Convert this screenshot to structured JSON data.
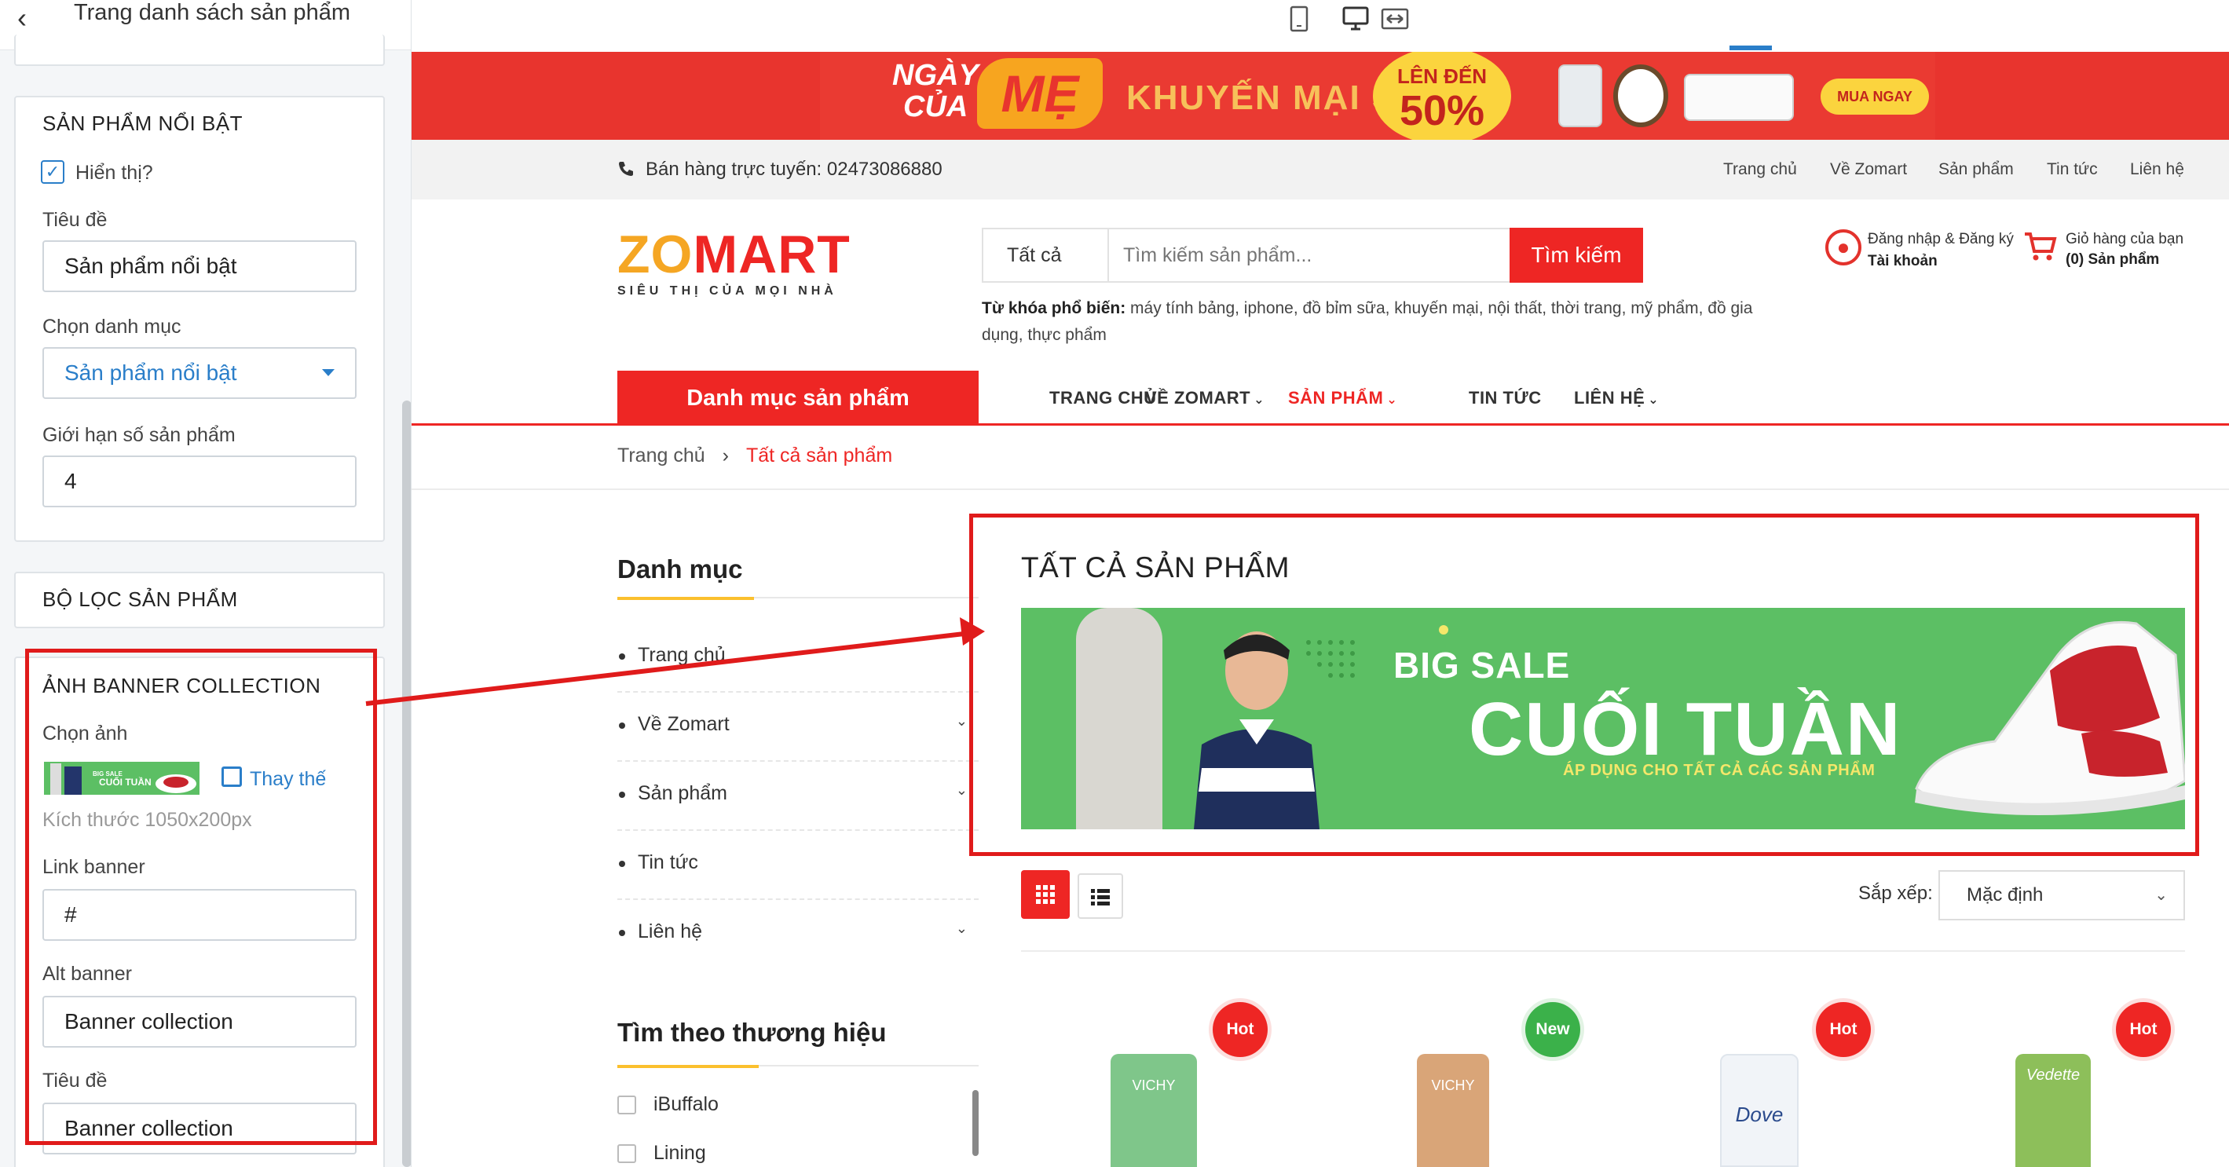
{
  "panel": {
    "back_glyph": "‹",
    "title": "Trang danh sách sản phẩm",
    "featured": {
      "title": "SẢN PHẨM NỔI BẬT",
      "show_label": "Hiển thị?",
      "show_checked": true,
      "title_label": "Tiêu đề",
      "title_value": "Sản phẩm nổi bật",
      "category_label": "Chọn danh mục",
      "category_value": "Sản phẩm nổi bật",
      "limit_label": "Giới hạn số sản phẩm",
      "limit_value": "4"
    },
    "filter": {
      "title": "BỘ LỌC SẢN PHẨM"
    },
    "banner": {
      "title": "ẢNH BANNER COLLECTION",
      "choose_label": "Chọn ảnh",
      "replace_label": "Thay thế",
      "size_hint": "Kích thước 1050x200px",
      "link_label": "Link banner",
      "link_value": "#",
      "alt_label": "Alt banner",
      "alt_value": "Banner collection",
      "title_label": "Tiêu đề",
      "title_value": "Banner collection"
    }
  },
  "device_toolbar": {
    "icons": [
      "tablet-icon",
      "desktop-icon",
      "fullwidth-icon"
    ],
    "active": "desktop-icon"
  },
  "promo": {
    "ngay": "NGÀY",
    "cua": "CỦA",
    "me": "MẸ",
    "slogan": "KHUYẾN MẠI SỐC",
    "upto": "LÊN ĐẾN",
    "percent": "50%",
    "cta": "MUA NGAY"
  },
  "topbar": {
    "phone": "Bán hàng trực tuyến: 02473086880",
    "links": [
      "Trang chủ",
      "Về Zomart",
      "Sản phẩm",
      "Tin tức",
      "Liên hệ"
    ]
  },
  "logo": {
    "text_zo": "ZO",
    "text_mart": "MART",
    "tagline": "SIÊU THỊ CỦA MỌI NHÀ"
  },
  "search": {
    "category": "Tất cả",
    "placeholder": "Tìm kiếm sản phẩm...",
    "button": "Tìm kiếm",
    "keywords_label": "Từ khóa phổ biến:",
    "keywords": "máy tính bảng, iphone, đồ bỉm sữa, khuyến mại, nội thất, thời trang, mỹ phẩm, đồ gia dụng, thực phẩm"
  },
  "account": {
    "line1": "Đăng nhập & Đăng ký",
    "line2": "Tài khoản"
  },
  "cart": {
    "line1": "Giỏ hàng của bạn",
    "line2": "(0) Sản phẩm"
  },
  "mainnav": {
    "category_button": "Danh mục sản phẩm",
    "items": [
      {
        "label": "TRANG CHỦ",
        "caret": ""
      },
      {
        "label": "VỀ ZOMART",
        "caret": "⌄"
      },
      {
        "label": "SẢN PHẨM",
        "caret": "⌄"
      },
      {
        "label": "TIN TỨC",
        "caret": ""
      },
      {
        "label": "LIÊN HỆ",
        "caret": "⌄"
      }
    ],
    "active_index": 2
  },
  "breadcrumb": {
    "home": "Trang chủ",
    "sep": "›",
    "current": "Tất cả sản phẩm"
  },
  "sidebar": {
    "title": "Danh mục",
    "items": [
      {
        "label": "Trang chủ",
        "chevron": ""
      },
      {
        "label": "Về Zomart",
        "chevron": "⌄"
      },
      {
        "label": "Sản phẩm",
        "chevron": "⌄"
      },
      {
        "label": "Tin tức",
        "chevron": ""
      },
      {
        "label": "Liên hệ",
        "chevron": "⌄"
      }
    ],
    "brand_title": "Tìm theo thương hiệu",
    "brands": [
      "iBuffalo",
      "Lining"
    ]
  },
  "collection": {
    "title": "TẤT CẢ SẢN PHẨM",
    "banner": {
      "big_sale": "BIG SALE",
      "headline": "CUỐI TUẦN",
      "sub": "ÁP DỤNG CHO TẤT CẢ CÁC SẢN PHẨM"
    },
    "sort_label": "Sắp xếp:",
    "sort_value": "Mặc định",
    "products": [
      {
        "badge": "Hot",
        "brand": "VICHY",
        "color": "#7fc68a"
      },
      {
        "badge": "New",
        "brand": "VICHY",
        "color": "#d9a578"
      },
      {
        "badge": "Hot",
        "brand": "Dove",
        "color": "#f1f4f8"
      },
      {
        "badge": "Hot",
        "brand": "Vedette",
        "color": "#8dbf5a"
      }
    ]
  },
  "colors": {
    "accent_red": "#ee2624",
    "link_blue": "#2a7ec9",
    "annotation_red": "#e01b1b",
    "banner_green": "#5cbf64"
  }
}
